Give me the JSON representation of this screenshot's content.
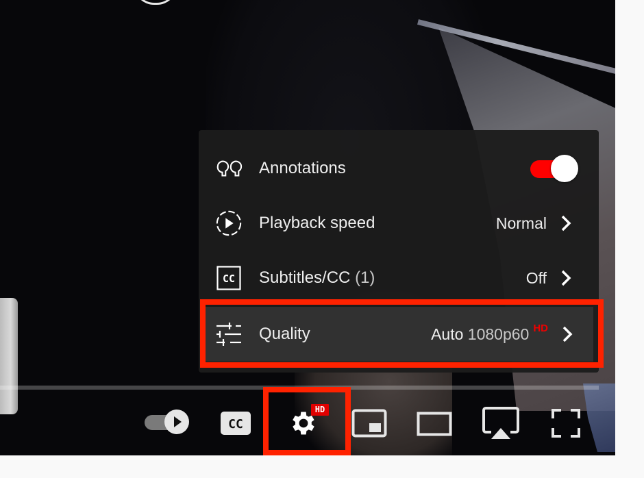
{
  "settings_menu": {
    "items": [
      {
        "id": "annotations",
        "icon": "annotations-icon",
        "label": "Annotations",
        "toggle_on": true
      },
      {
        "id": "playback-speed",
        "icon": "playback-speed-icon",
        "label": "Playback speed",
        "value": "Normal"
      },
      {
        "id": "subtitles",
        "icon": "subtitles-icon",
        "label": "Subtitles/CC",
        "label_suffix": "(1)",
        "value": "Off"
      },
      {
        "id": "quality",
        "icon": "quality-sliders-icon",
        "label": "Quality",
        "value_prefix": "Auto",
        "value": "1080p60",
        "value_badge": "HD",
        "highlighted": true
      }
    ]
  },
  "controls": {
    "autoplay": {
      "label": "Autoplay",
      "on": false
    },
    "subtitles": {
      "label": "CC"
    },
    "settings": {
      "badge": "HD",
      "highlighted": true
    },
    "miniplayer": {
      "label": "Miniplayer"
    },
    "theater": {
      "label": "Theater mode"
    },
    "airplay": {
      "label": "AirPlay"
    },
    "fullscreen": {
      "label": "Full screen"
    }
  },
  "colors": {
    "accent_red": "#ff0000",
    "highlight_box": "#ff2200",
    "hd_badge": "#e00000"
  }
}
